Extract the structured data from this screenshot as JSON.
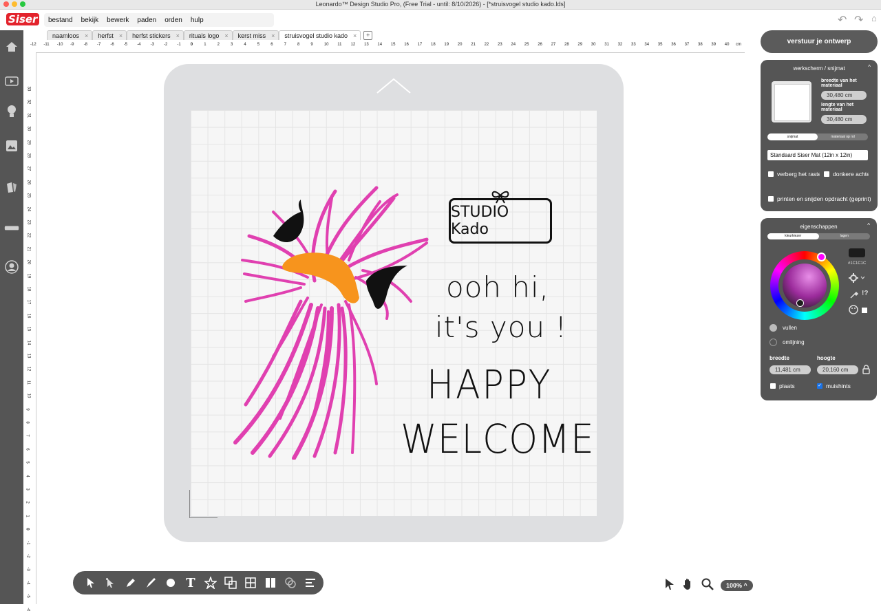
{
  "window": {
    "title": "Leonardo™ Design Studio Pro, (Free Trial - until: 8/10/2026) - [*struisvogel studio kado.lds]"
  },
  "app": {
    "logo_text": "Siser"
  },
  "menu": [
    {
      "label": "bestand"
    },
    {
      "label": "bekijk"
    },
    {
      "label": "bewerk"
    },
    {
      "label": "paden"
    },
    {
      "label": "orden"
    },
    {
      "label": "hulp"
    }
  ],
  "tabs": [
    {
      "label": "naamloos"
    },
    {
      "label": "herfst"
    },
    {
      "label": "herfst stickers"
    },
    {
      "label": "rituals logo"
    },
    {
      "label": "kerst miss"
    },
    {
      "label": "struisvogel studio kado"
    }
  ],
  "ruler": {
    "unit": "cm",
    "h_labels": [
      "-12",
      "-11",
      "-10",
      "-9",
      "-8",
      "-7",
      "-6",
      "-5",
      "-4",
      "-3",
      "-2",
      "-1",
      "0",
      "1",
      "2",
      "3",
      "4",
      "5",
      "6",
      "7",
      "8",
      "9",
      "10",
      "11",
      "12",
      "13",
      "14",
      "15",
      "16",
      "17",
      "18",
      "19",
      "20",
      "21",
      "22",
      "23",
      "24",
      "25",
      "26",
      "27",
      "28",
      "29",
      "30",
      "31",
      "32",
      "33",
      "34",
      "35",
      "36",
      "37",
      "38",
      "39",
      "40"
    ],
    "v_labels": [
      "33",
      "32",
      "31",
      "30",
      "29",
      "28",
      "27",
      "26",
      "25",
      "24",
      "23",
      "22",
      "21",
      "20",
      "19",
      "18",
      "17",
      "16",
      "15",
      "14",
      "13",
      "12",
      "11",
      "10",
      "9",
      "8",
      "7",
      "6",
      "5",
      "4",
      "3",
      "2",
      "1",
      "0",
      "-1",
      "-2",
      "-3",
      "-4",
      "-5",
      "-6"
    ]
  },
  "design": {
    "box_text": "STUDIO Kado",
    "line1": "ooh hi,",
    "line2": "it's you !",
    "line3": "HAPPY",
    "line4": "WELCOME",
    "colors": {
      "feathers": "#e040b0",
      "beak": "#f7941d",
      "eyes": "#111111"
    }
  },
  "right_panel": {
    "send_button": "verstuur je ontwerp",
    "workspace": {
      "title": "werkscherm / snijmat",
      "width_label": "breedte van het materiaal",
      "width_value": "30,480 cm",
      "length_label": "lengte van het materiaal",
      "length_value": "30,480 cm",
      "seg_options": [
        "snijmat",
        "materiaal op rol"
      ],
      "mat_select": "Standaard Siser Mat (12in x 12in)",
      "hide_grid": "verberg het raster",
      "darker": "donkere achtergrond",
      "print_cut": "printen en snijden opdracht (geprint)"
    },
    "properties": {
      "title": "eigenschappen",
      "seg_options": [
        "kleurkiezer",
        "lagen"
      ],
      "hex": "#1C1C1C",
      "swatch_color": "#1C1C1C",
      "fill": "vullen",
      "outline": "omlijning",
      "width_label": "breedte",
      "width_value": "11,481 cm",
      "height_label": "hoogte",
      "height_value": "20,160 cm",
      "place": "plaats",
      "mousehints": "muishints"
    }
  },
  "zoom": {
    "label": "100%"
  }
}
